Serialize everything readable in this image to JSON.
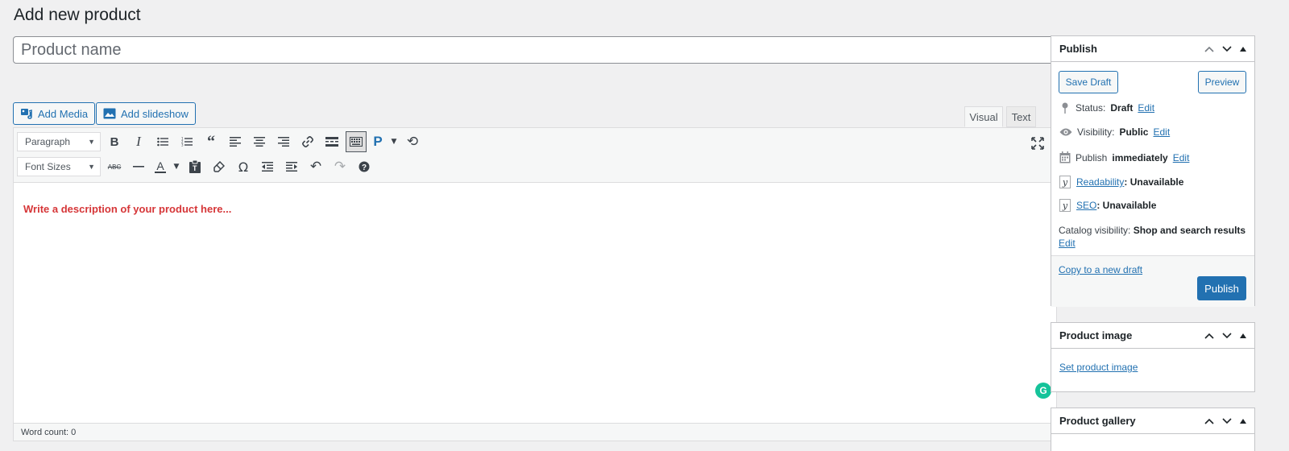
{
  "page": {
    "title": "Add new product"
  },
  "title_field": {
    "placeholder": "Product name",
    "value": ""
  },
  "media_buttons": {
    "add_media": "Add Media",
    "add_slideshow": "Add slideshow"
  },
  "editor_tabs": {
    "visual": "Visual",
    "text": "Text",
    "active": "visual"
  },
  "toolbar": {
    "format_select": "Paragraph",
    "font_size_select": "Font Sizes",
    "row1_icons": [
      "bold-icon",
      "italic-icon",
      "bullet-list-icon",
      "numbered-list-icon",
      "blockquote-icon",
      "align-left-icon",
      "align-center-icon",
      "align-right-icon",
      "link-icon",
      "read-more-icon",
      "toolbar-toggle-icon",
      "p-icon",
      "refresh-icon"
    ],
    "row2_icons": [
      "strikethrough-icon",
      "horizontal-line-icon",
      "text-color-icon",
      "paste-text-icon",
      "clear-formatting-icon",
      "special-character-icon",
      "outdent-icon",
      "indent-icon",
      "undo-icon",
      "redo-icon",
      "help-icon"
    ]
  },
  "editor": {
    "placeholder": "Write a description of your product here...",
    "word_count": "Word count: 0"
  },
  "publish_box": {
    "title": "Publish",
    "save_draft": "Save Draft",
    "preview": "Preview",
    "status_label": "Status:",
    "status_value": "Draft",
    "visibility_label": "Visibility:",
    "visibility_value": "Public",
    "publish_label": "Publish",
    "publish_value": "immediately",
    "readability_link": "Readability",
    "readability_value": ": Unavailable",
    "seo_link": "SEO",
    "seo_value": ": Unavailable",
    "catalog_label": "Catalog visibility:",
    "catalog_value": "Shop and search results",
    "edit": "Edit",
    "copy_draft": "Copy to a new draft",
    "publish_button": "Publish"
  },
  "product_image_box": {
    "title": "Product image",
    "link": "Set product image"
  },
  "product_gallery_box": {
    "title": "Product gallery"
  },
  "colors": {
    "primary": "#2271b1",
    "placeholder_red": "#d63638",
    "grammarly": "#15c39a"
  }
}
